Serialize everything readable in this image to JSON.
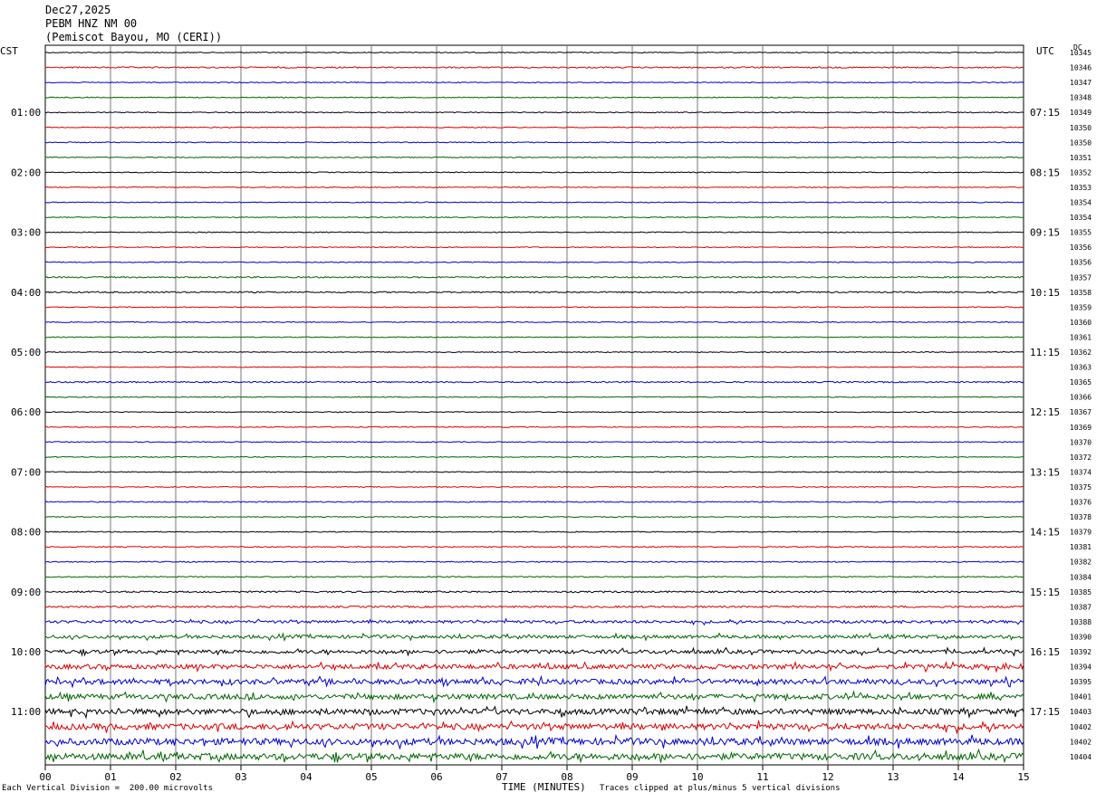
{
  "header": {
    "date": "Dec27,2025",
    "station": "PEBM HNZ NM 00",
    "location": "(Pemiscot Bayou, MO (CERI))"
  },
  "left_tz": "CST",
  "right_tz": "UTC",
  "dc_label": "DC",
  "chart_data": {
    "type": "seismogram",
    "xlabel": "TIME (MINUTES)",
    "x_ticks": [
      "00",
      "01",
      "02",
      "03",
      "04",
      "05",
      "06",
      "07",
      "08",
      "09",
      "10",
      "11",
      "12",
      "13",
      "14",
      "15"
    ],
    "xlim": [
      0,
      15
    ],
    "left_hour_labels": [
      "01:00",
      "02:00",
      "03:00",
      "04:00",
      "05:00",
      "06:00",
      "07:00",
      "08:00",
      "09:00",
      "10:00",
      "11:00"
    ],
    "right_hour_labels": [
      "07:15",
      "08:15",
      "09:15",
      "10:15",
      "11:15",
      "12:15",
      "13:15",
      "14:15",
      "15:15",
      "16:15",
      "17:15"
    ],
    "trace_colors": [
      "#000000",
      "#dd0000",
      "#0000cc",
      "#006600"
    ],
    "trace_count": 48,
    "dc_offsets": [
      "10345",
      "10346",
      "10347",
      "10348",
      "10349",
      "10350",
      "10350",
      "10351",
      "10352",
      "10353",
      "10354",
      "10354",
      "10355",
      "10356",
      "10356",
      "10357",
      "10358",
      "10359",
      "10360",
      "10361",
      "10362",
      "10363",
      "10365",
      "10366",
      "10367",
      "10369",
      "10370",
      "10372",
      "10374",
      "10375",
      "10376",
      "10378",
      "10379",
      "10381",
      "10382",
      "10384",
      "10385",
      "10387",
      "10388",
      "10390",
      "10392",
      "10394",
      "10395",
      "10401",
      "10403",
      "10402",
      "10402",
      "10404"
    ],
    "noise_levels": [
      1,
      1.5,
      1,
      1,
      1,
      1,
      1,
      1,
      1,
      1,
      1,
      1,
      1,
      1,
      1,
      1.5,
      1.5,
      1,
      1,
      1,
      1,
      1,
      1.5,
      1,
      1,
      1,
      1,
      1,
      1,
      1,
      1.2,
      1,
      1,
      1.2,
      1.2,
      1.2,
      1.8,
      2,
      3,
      3.5,
      4,
      5,
      5.5,
      5.5,
      6,
      6.5,
      7,
      7
    ]
  },
  "footer": {
    "scale_note": "Each Vertical Division =  200.00 microvolts",
    "clip_note": "Traces clipped at plus/minus 5 vertical divisions"
  }
}
